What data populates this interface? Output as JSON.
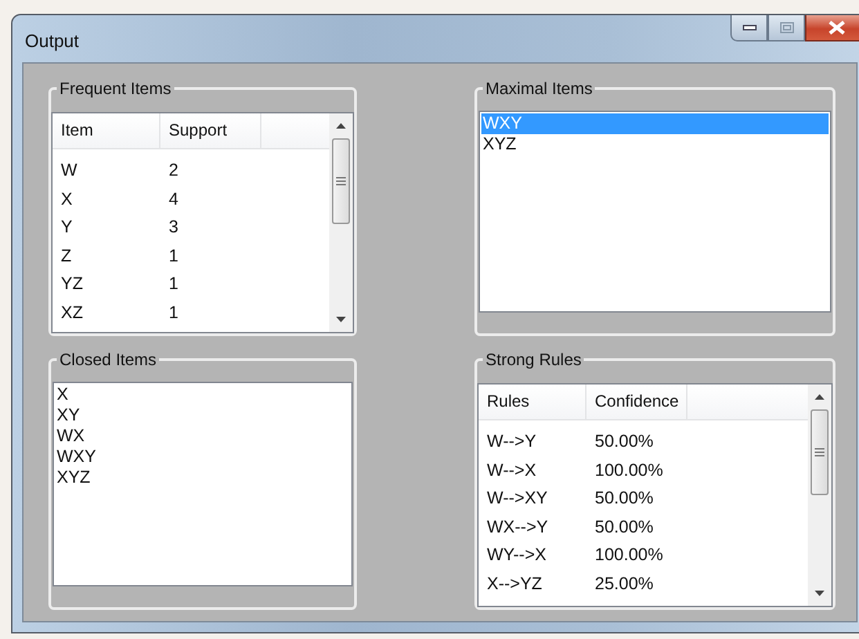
{
  "window": {
    "title": "Output"
  },
  "frequent_items": {
    "title": "Frequent Items",
    "columns": [
      "Item",
      "Support"
    ],
    "rows": [
      [
        "W",
        "2"
      ],
      [
        "X",
        "4"
      ],
      [
        "Y",
        "3"
      ],
      [
        "Z",
        "1"
      ],
      [
        "YZ",
        "1"
      ],
      [
        "XZ",
        "1"
      ]
    ]
  },
  "maximal_items": {
    "title": "Maximal Items",
    "items": [
      {
        "label": "WXY",
        "selected": true
      },
      {
        "label": "XYZ",
        "selected": false
      }
    ]
  },
  "closed_items": {
    "title": "Closed Items",
    "items": [
      {
        "label": "X",
        "selected": false
      },
      {
        "label": "XY",
        "selected": false
      },
      {
        "label": "WX",
        "selected": false
      },
      {
        "label": "WXY",
        "selected": false
      },
      {
        "label": "XYZ",
        "selected": false
      }
    ]
  },
  "strong_rules": {
    "title": "Strong Rules",
    "columns": [
      "Rules",
      "Confidence"
    ],
    "rows": [
      [
        "W-->Y",
        "50.00%"
      ],
      [
        "W-->X",
        "100.00%"
      ],
      [
        "W-->XY",
        "50.00%"
      ],
      [
        "WX-->Y",
        "50.00%"
      ],
      [
        "WY-->X",
        "100.00%"
      ],
      [
        "X-->YZ",
        "25.00%"
      ]
    ]
  }
}
